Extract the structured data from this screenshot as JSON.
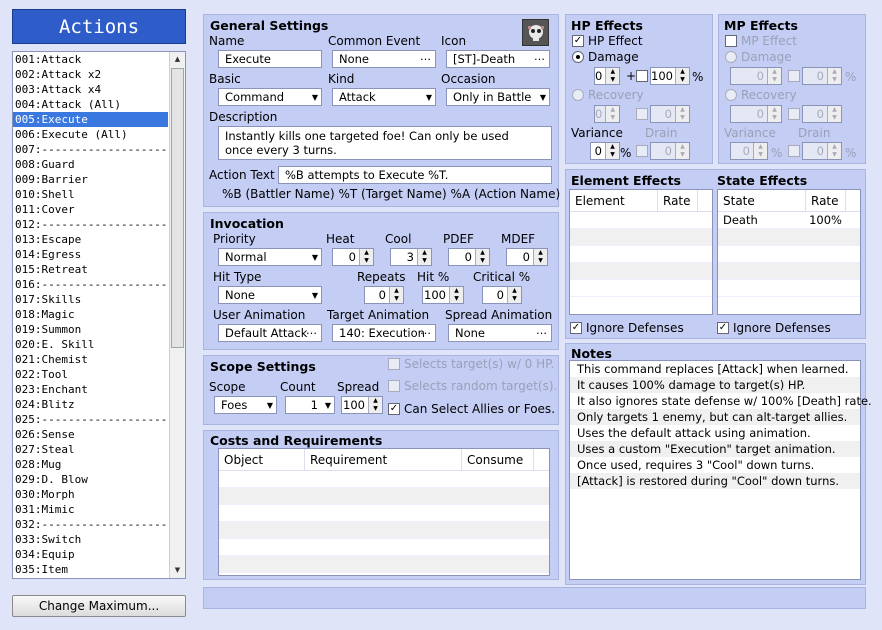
{
  "sidebar": {
    "title": "Actions",
    "change_max": "Change Maximum...",
    "items": [
      "001:Attack",
      "002:Attack x2",
      "003:Attack x4",
      "004:Attack (All)",
      "005:Execute",
      "006:Execute (All)",
      "007:--------------------",
      "008:Guard",
      "009:Barrier",
      "010:Shell",
      "011:Cover",
      "012:--------------------",
      "013:Escape",
      "014:Egress",
      "015:Retreat",
      "016:--------------------",
      "017:Skills",
      "018:Magic",
      "019:Summon",
      "020:E. Skill",
      "021:Chemist",
      "022:Tool",
      "023:Enchant",
      "024:Blitz",
      "025:--------------------",
      "026:Sense",
      "027:Steal",
      "028:Mug",
      "029:D. Blow",
      "030:Morph",
      "031:Mimic",
      "032:--------------------",
      "033:Switch",
      "034:Equip",
      "035:Item"
    ],
    "selected_index": 4
  },
  "general": {
    "title": "General Settings",
    "name_label": "Name",
    "name": "Execute",
    "common_event_label": "Common Event",
    "common_event": "None",
    "icon_label": "Icon",
    "icon": "[ST]-Death",
    "basic_label": "Basic",
    "basic": "Command",
    "kind_label": "Kind",
    "kind": "Attack",
    "occasion_label": "Occasion",
    "occasion": "Only in Battle",
    "description_label": "Description",
    "description_line1": "Instantly kills one targeted foe! Can only be used",
    "description_line2": "once every 3 turns.",
    "action_text_label": "Action Text",
    "action_text": "%B attempts to Execute %T.",
    "action_hint": "%B (Battler Name) %T (Target Name) %A (Action Name)"
  },
  "invocation": {
    "title": "Invocation",
    "priority_label": "Priority",
    "priority": "Normal",
    "heat_label": "Heat",
    "heat": "0",
    "cool_label": "Cool",
    "cool": "3",
    "pdef_label": "PDEF",
    "pdef": "0",
    "mdef_label": "MDEF",
    "mdef": "0",
    "hit_type_label": "Hit Type",
    "hit_type": "None",
    "repeats_label": "Repeats",
    "repeats": "0",
    "hit_pct_label": "Hit %",
    "hit_pct": "100",
    "critical_label": "Critical %",
    "critical": "0",
    "user_anim_label": "User Animation",
    "user_anim": "Default Attack",
    "target_anim_label": "Target Animation",
    "target_anim": "140: Execution",
    "spread_anim_label": "Spread Animation",
    "spread_anim": "None"
  },
  "scope": {
    "title": "Scope Settings",
    "scope_label": "Scope",
    "scope": "Foes",
    "count_label": "Count",
    "count": "1",
    "spread_label": "Spread",
    "spread": "100",
    "opt1": "Selects target(s) w/ 0 HP.",
    "opt2": "Selects random target(s).",
    "opt3": "Can Select Allies or Foes."
  },
  "costs": {
    "title": "Costs and Requirements",
    "columns": [
      "Object",
      "Requirement",
      "Consume"
    ]
  },
  "hp": {
    "title": "HP Effects",
    "effect_label": "HP Effect",
    "damage_label": "Damage",
    "damage_value": "0",
    "damage_pct": "100",
    "recovery_label": "Recovery",
    "recovery_value": "0",
    "recovery_pct": "0",
    "variance_label": "Variance",
    "variance": "0",
    "drain_label": "Drain",
    "drain": "0",
    "pct_sign": "%",
    "plus_sign": "+"
  },
  "mp": {
    "title": "MP Effects",
    "effect_label": "MP Effect",
    "damage_label": "Damage",
    "damage_value": "0",
    "damage_pct": "0",
    "recovery_label": "Recovery",
    "recovery_value": "0",
    "recovery_pct": "0",
    "variance_label": "Variance",
    "variance": "0",
    "drain_label": "Drain",
    "drain": "0"
  },
  "element": {
    "title": "Element Effects",
    "columns": [
      "Element",
      "Rate"
    ],
    "ignore": "Ignore Defenses"
  },
  "state": {
    "title": "State Effects",
    "columns": [
      "State",
      "Rate"
    ],
    "rows": [
      {
        "state": "Death",
        "rate": "100%"
      }
    ],
    "ignore": "Ignore Defenses"
  },
  "notes": {
    "title": "Notes",
    "lines": [
      "This command replaces [Attack] when learned.",
      "It causes 100% damage to target(s) HP.",
      "It also ignores state defense w/ 100% [Death] rate.",
      "Only targets 1 enemy, but can alt-target allies.",
      "Uses the default attack using animation.",
      "Uses a custom \"Execution\" target animation.",
      "Once used, requires 3 \"Cool\" down turns.",
      "[Attack] is restored during \"Cool\" down turns."
    ]
  },
  "icons": {
    "dropdown": "chevron-down-icon",
    "ellipsis": "ellipsis-icon",
    "skull": "skull-icon"
  }
}
